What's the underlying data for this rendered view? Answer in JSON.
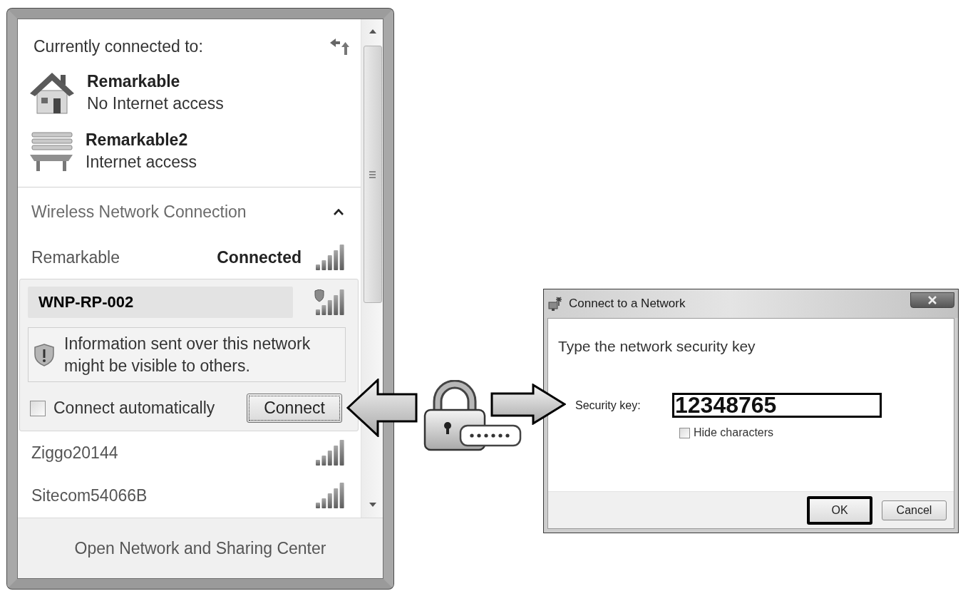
{
  "network_flyout": {
    "header": "Currently connected to:",
    "connections": [
      {
        "kind": "home",
        "name": "Remarkable",
        "status": "No Internet access"
      },
      {
        "kind": "public",
        "name": "Remarkable2",
        "status": "Internet access"
      }
    ],
    "section": {
      "title": "Wireless Network Connection",
      "expanded": true
    },
    "networks": [
      {
        "name": "Remarkable",
        "status": "Connected",
        "selected": false,
        "unsecured": false
      },
      {
        "name": "WNP-RP-002",
        "selected": true,
        "unsecured": true,
        "warning": "Information sent over this network might be visible to others.",
        "auto_connect": {
          "label": "Connect automatically",
          "checked": false
        },
        "button": "Connect"
      },
      {
        "name": "Ziggo20144",
        "selected": false,
        "unsecured": false
      },
      {
        "name": "Sitecom54066B",
        "selected": false,
        "unsecured": false
      }
    ],
    "footer_link": "Open Network and Sharing Center"
  },
  "dialog": {
    "title": "Connect to a Network",
    "prompt": "Type the network security key",
    "field_label": "Security key:",
    "value": "12348765",
    "hide_characters": {
      "label": "Hide characters",
      "checked": false
    },
    "buttons": [
      {
        "label": "OK",
        "highlighted": true
      },
      {
        "label": "Cancel",
        "highlighted": false
      }
    ]
  }
}
